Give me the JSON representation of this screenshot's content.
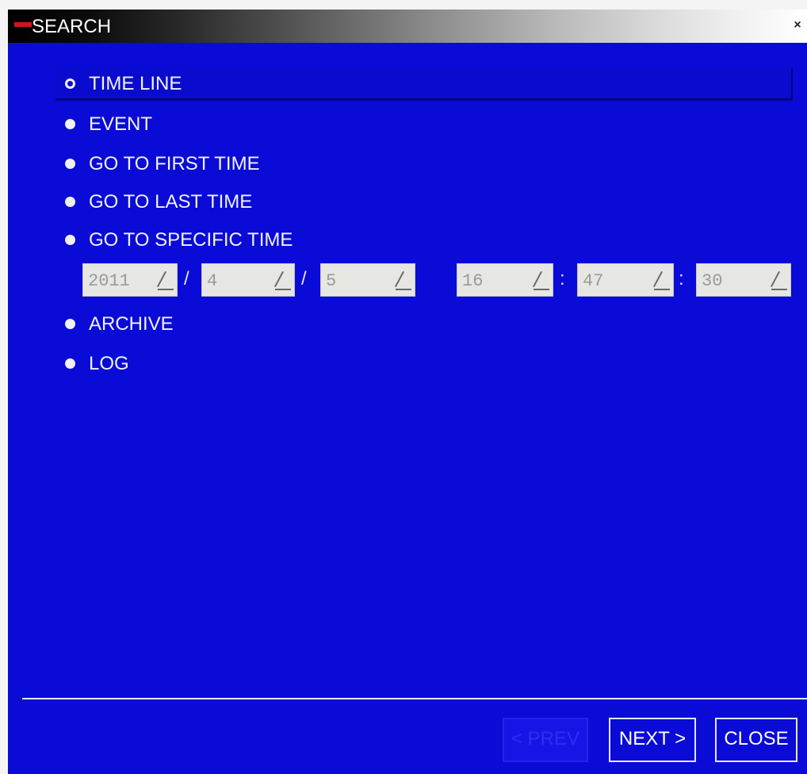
{
  "window": {
    "title": "SEARCH",
    "close_glyph": "×"
  },
  "options": [
    {
      "label": "TIME LINE",
      "selected": true
    },
    {
      "label": "EVENT",
      "selected": false
    },
    {
      "label": "GO TO FIRST TIME",
      "selected": false
    },
    {
      "label": "GO TO LAST TIME",
      "selected": false
    },
    {
      "label": "GO TO SPECIFIC TIME",
      "selected": false
    },
    {
      "label": "ARCHIVE",
      "selected": false
    },
    {
      "label": "LOG",
      "selected": false
    }
  ],
  "specific_time": {
    "year": "2011",
    "month": "4",
    "day": "5",
    "hour": "16",
    "minute": "47",
    "second": "30",
    "date_separator": "/",
    "time_separator": ":"
  },
  "buttons": {
    "prev_label": "< PREV",
    "next_label": "NEXT >",
    "close_label": "CLOSE"
  },
  "colors": {
    "background": "#0a0bd6",
    "title_accent": "#d01515",
    "text": "#f0f2ff"
  },
  "icons": {
    "radio": "radio-icon",
    "spin": "spin-icon",
    "close": "close-icon"
  }
}
